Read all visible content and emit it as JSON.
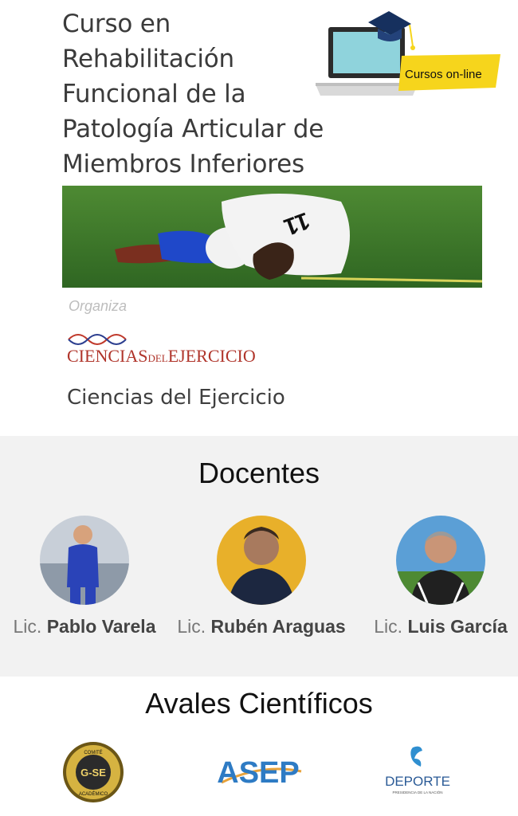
{
  "course": {
    "title_lines": [
      "Curso en",
      "Rehabilitación",
      "Funcional de la",
      "Patología Articular de",
      "Miembros Inferiores"
    ]
  },
  "badge": {
    "label": "Cursos on-line"
  },
  "hero": {
    "jersey_number": "11"
  },
  "organizer": {
    "label": "Organiza",
    "logo_text": "CIENCIAS",
    "logo_text_small": "DEL",
    "logo_text_end": "EJERCICIO",
    "name": "Ciencias del Ejercicio"
  },
  "docentes": {
    "title": "Docentes",
    "people": [
      {
        "prefix": "Lic.",
        "name": "Pablo Varela"
      },
      {
        "prefix": "Lic.",
        "name": "Rubén Araguas"
      },
      {
        "prefix": "Lic.",
        "name": "Luis García"
      }
    ]
  },
  "avales": {
    "title": "Avales Científicos",
    "logos": [
      {
        "main": "G-SE",
        "ring_top": "COMITÉ",
        "ring_bottom": "ACADÉMICO"
      },
      {
        "main": "ASEP"
      },
      {
        "main": "DEPORTE",
        "sub": "PRESIDENCIA DE LA NACIÓN"
      }
    ]
  },
  "colors": {
    "badge_yellow": "#f6d51c",
    "section_bg": "#f2f2f2",
    "field_green": "#3d7a2a"
  }
}
